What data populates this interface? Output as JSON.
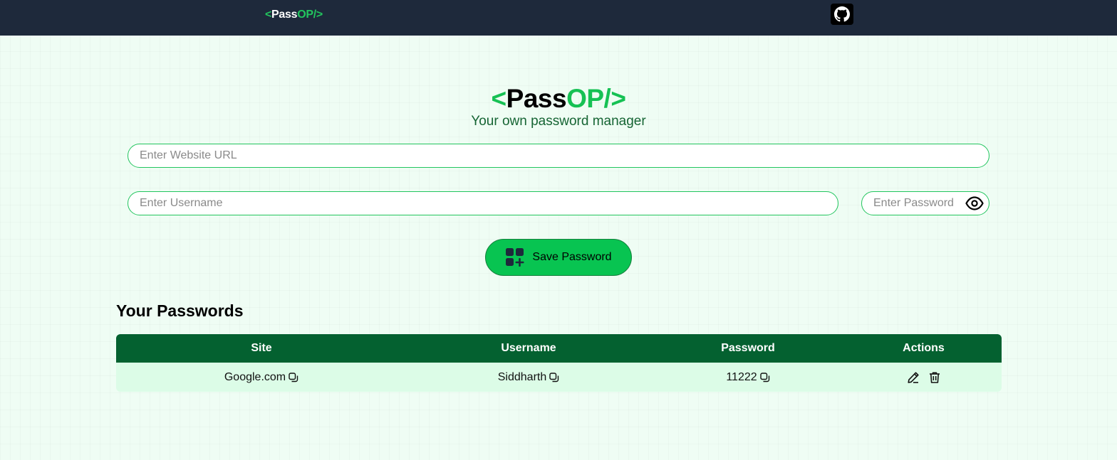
{
  "nav": {
    "logo_open": "<",
    "logo_pass": "Pass",
    "logo_op": "OP/",
    "logo_close": ">",
    "github_icon": "github-icon"
  },
  "hero": {
    "brand_open": "<",
    "brand_pass": "Pass",
    "brand_op": "OP/>",
    "tagline": "Your own password manager"
  },
  "form": {
    "url_placeholder": "Enter Website URL",
    "username_placeholder": "Enter Username",
    "password_placeholder": "Enter Password",
    "save_label": "Save Password"
  },
  "passwords": {
    "title": "Your Passwords",
    "columns": [
      "Site",
      "Username",
      "Password",
      "Actions"
    ],
    "rows": [
      {
        "site": "Google.com",
        "username": "Siddharth",
        "password": "11222"
      }
    ]
  },
  "colors": {
    "navbar": "#1e293b",
    "accent": "#22c55e",
    "table_header": "#046130",
    "row_bg": "#dcfce7",
    "background": "#effdf4"
  }
}
